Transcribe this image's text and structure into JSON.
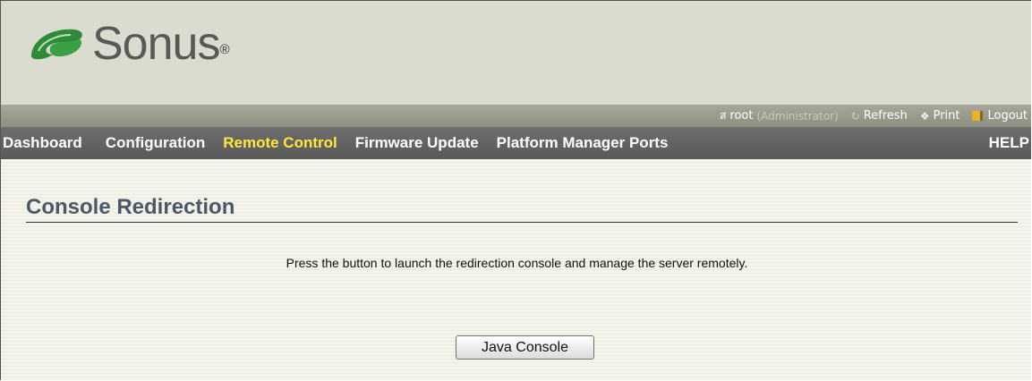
{
  "brand": {
    "name": "Sonus",
    "registered_mark": "®",
    "logo_icon": "swoosh-logo-icon",
    "colors": {
      "logo_green": "#2e8b3a",
      "logo_text": "#585a57"
    }
  },
  "utility_bar": {
    "user": {
      "icon": "user-icon",
      "name": "root",
      "role": "(Administrator)"
    },
    "refresh": {
      "icon": "refresh-icon",
      "label": "Refresh"
    },
    "print": {
      "icon": "print-icon",
      "label": "Print"
    },
    "logout": {
      "icon": "logout-icon",
      "label": "Logout"
    }
  },
  "nav": {
    "items": [
      {
        "label": "Dashboard",
        "active": false
      },
      {
        "label": "Configuration",
        "active": false
      },
      {
        "label": "Remote Control",
        "active": true
      },
      {
        "label": "Firmware Update",
        "active": false
      },
      {
        "label": "Platform Manager Ports",
        "active": false
      }
    ],
    "help": "HELP",
    "colors": {
      "active": "#ffe838",
      "bar": "#616161"
    }
  },
  "main": {
    "title": "Console Redirection",
    "description": "Press the button to launch the redirection console and manage the server remotely.",
    "button_label": "Java Console"
  }
}
